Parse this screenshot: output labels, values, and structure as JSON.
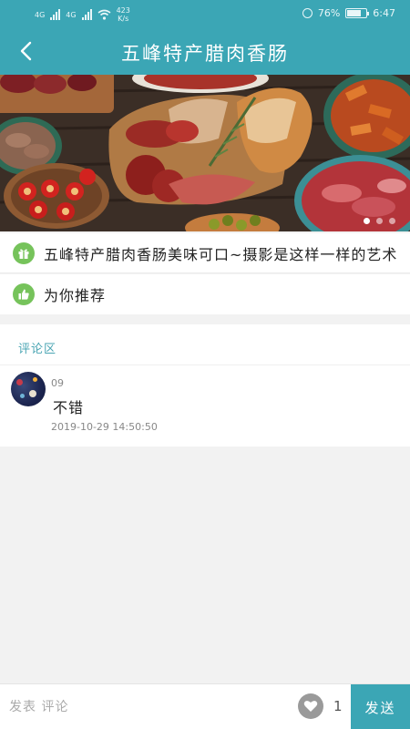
{
  "status_bar": {
    "network_label_1": "4G",
    "network_label_2": "4G",
    "net_speed_value": "423",
    "net_speed_unit": "K/s",
    "battery_percent": "76%",
    "battery_level": 0.76,
    "time": "6:47"
  },
  "header": {
    "title": "五峰特产腊肉香肠"
  },
  "banner": {
    "slide_count": 3,
    "active_slide": 0
  },
  "article": {
    "summary": "五峰特产腊肉香肠美味可口~摄影是这样一样的艺术"
  },
  "recommend": {
    "label": "为你推荐"
  },
  "comments": {
    "section_title": "评论区",
    "items": [
      {
        "user": "09",
        "content": "不错",
        "time": "2019-10-29 14:50:50"
      }
    ]
  },
  "bottom_bar": {
    "input_placeholder": "发表 评论",
    "like_count": "1",
    "send_label": "发送"
  },
  "colors": {
    "theme": "#3ba6b5",
    "icon_green": "#76c35b"
  }
}
